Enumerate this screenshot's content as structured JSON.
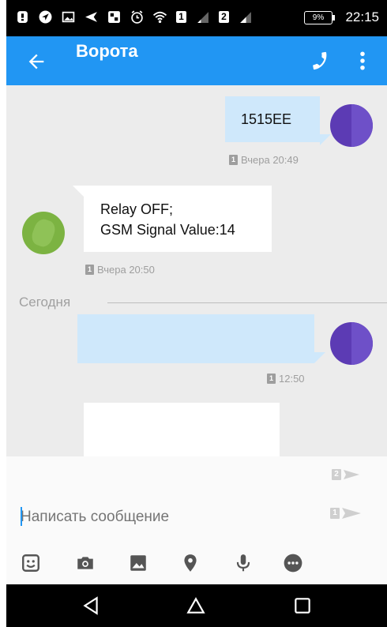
{
  "status_bar": {
    "icons": [
      "notification-icon",
      "navigation-icon",
      "image-icon",
      "send-icon",
      "gallery-icon",
      "alarm-icon",
      "wifi-icon"
    ],
    "sim1_label": "1",
    "sim2_label": "2",
    "battery": "9%",
    "time": "22:15"
  },
  "app_bar": {
    "title": "Ворота",
    "back_icon": "back-arrow-icon",
    "call_icon": "phone-icon",
    "menu_icon": "more-vert-icon"
  },
  "conversation": {
    "messages": [
      {
        "direction": "outgoing",
        "lines": [
          "1515EE"
        ],
        "time": "Вчера 20:49",
        "sim": "1"
      },
      {
        "direction": "incoming",
        "lines": [
          "Relay OFF;",
          "GSM Signal Value:14"
        ],
        "time": "Вчера 20:50",
        "sim": "1"
      },
      {
        "direction": "outgoing",
        "lines": [],
        "time": "12:50",
        "sim": "1"
      },
      {
        "direction": "incoming",
        "lines": []
      }
    ],
    "day_divider": "Сегодня"
  },
  "composer": {
    "placeholder": "Написать сообщение",
    "value": "",
    "send_sim2_label": "2",
    "send_sim1_label": "1",
    "tools": [
      "sticker-icon",
      "camera-icon",
      "image-icon",
      "location-icon",
      "microphone-icon",
      "more-options-icon"
    ]
  },
  "colors": {
    "app_bar": "#2196f3",
    "outgoing_bubble": "#cfe8fb",
    "incoming_bubble": "#ffffff",
    "chat_background": "#ececec"
  }
}
